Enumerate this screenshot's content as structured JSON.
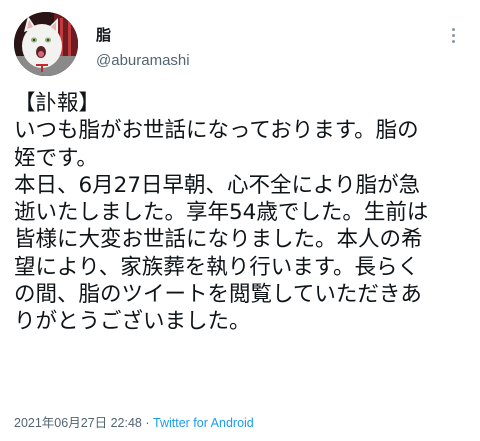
{
  "user": {
    "display_name": "脂",
    "handle": "@aburamashi"
  },
  "tweet": {
    "lines": [
      "【訃報】",
      "いつも脂がお世話になっております。脂の",
      "姪です。",
      "本日、6月27日早朝、心不全により脂が急",
      "逝いたしました。享年54歳でした。生前は",
      "皆様に大変お世話になりました。本人の希",
      "望により、家族葬を執り行います。長らく",
      "の間、脂のツイートを閲覧していただきあ",
      "りがとうございました。"
    ]
  },
  "meta": {
    "timestamp": "2021年06月27日 22:48",
    "separator": "·",
    "source": "Twitter for Android"
  },
  "icons": {
    "avatar": "white-cat-photo",
    "more": "more-vertical-icon"
  },
  "colors": {
    "text": "#0f1419",
    "secondary": "#536471",
    "link": "#1d9bf0"
  }
}
